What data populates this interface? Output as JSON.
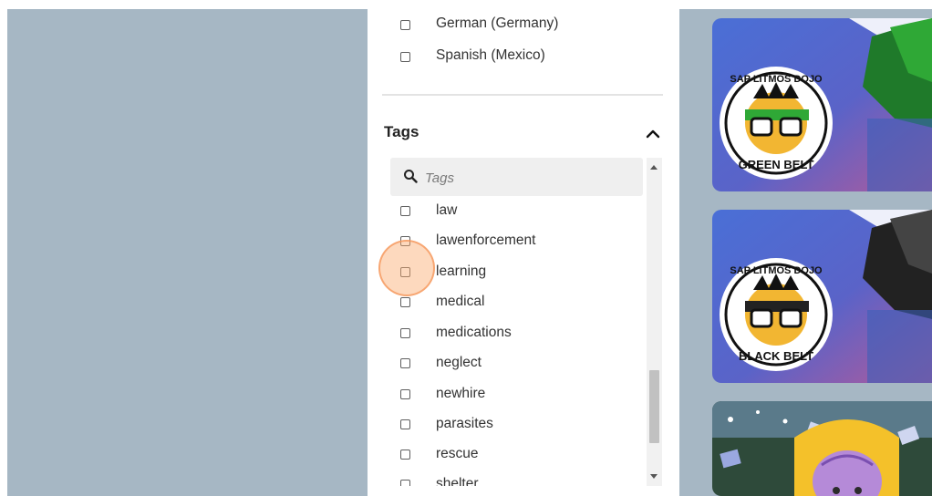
{
  "languages": [
    {
      "label": "German (Germany)",
      "checked": false
    },
    {
      "label": "Spanish (Mexico)",
      "checked": false
    }
  ],
  "tags": {
    "title": "Tags",
    "search_placeholder": "Tags",
    "items": [
      {
        "label": "law",
        "checked": false
      },
      {
        "label": "lawenforcement",
        "checked": false
      },
      {
        "label": "learning",
        "checked": false
      },
      {
        "label": "medical",
        "checked": false
      },
      {
        "label": "medications",
        "checked": false
      },
      {
        "label": "neglect",
        "checked": false
      },
      {
        "label": "newhire",
        "checked": false
      },
      {
        "label": "parasites",
        "checked": false
      },
      {
        "label": "rescue",
        "checked": false
      },
      {
        "label": "shelter",
        "checked": false
      }
    ]
  },
  "cards": [
    {
      "badge_top": "SAP LITMOS DOJO",
      "badge_bottom": "GREEN BELT",
      "belt_color": "#2fa836"
    },
    {
      "badge_top": "SAP LITMOS DOJO",
      "badge_bottom": "BLACK BELT",
      "belt_color": "#222222"
    }
  ],
  "colors": {
    "page_bg": "#a6b7c4",
    "panel_bg": "#ffffff",
    "search_bg": "#efefef",
    "click_indicator": "#f5a060"
  }
}
